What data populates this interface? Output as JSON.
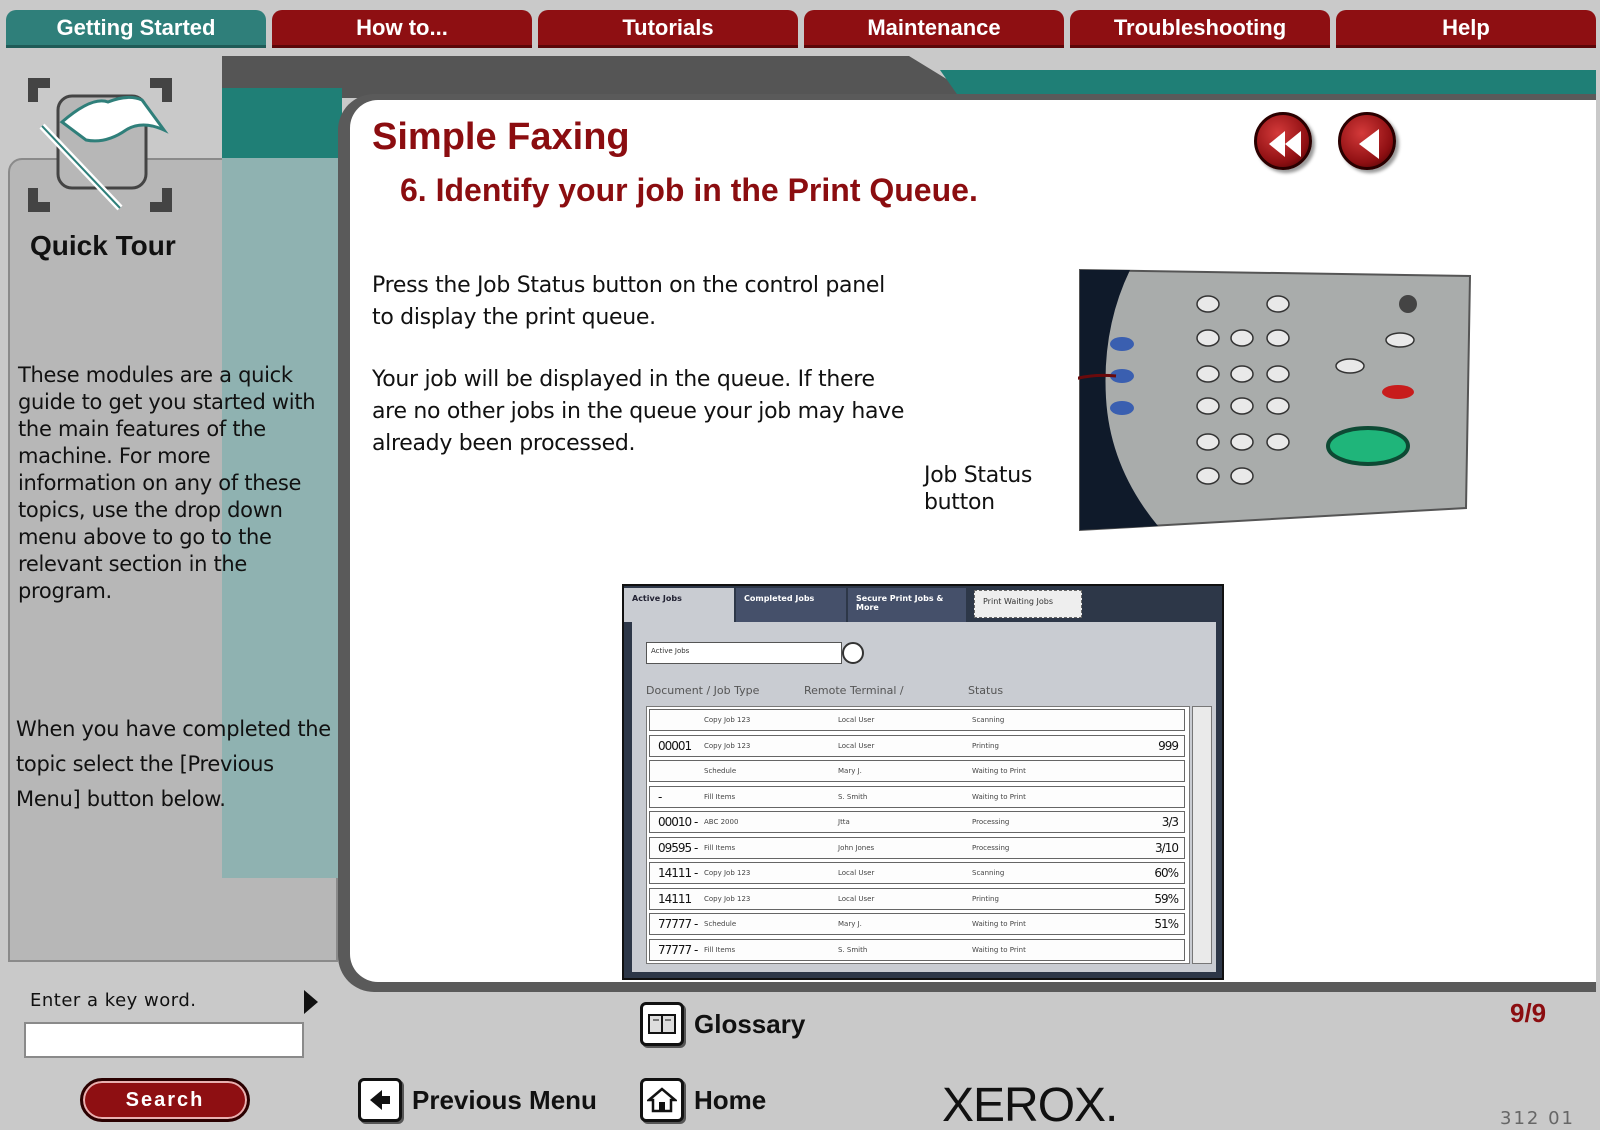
{
  "nav": {
    "tabs": [
      "Getting Started",
      "How to...",
      "Tutorials",
      "Maintenance",
      "Troubleshooting",
      "Help"
    ],
    "active_index": 0
  },
  "sidebar": {
    "title": "Quick Tour",
    "text1": "These modules are a quick guide to get you started with the main features of the machine. For more information on any of these topics, use the drop down menu above to go to the relevant section in the program.",
    "text2": "When you have completed the topic select the [Previous Menu] button below.",
    "keyword_label": "Enter a key word.",
    "keyword_value": "",
    "search_label": "Search"
  },
  "main": {
    "title": "Simple Faxing",
    "subtitle": "6. Identify your job in the Print Queue.",
    "paragraph1": "Press the Job Status button on the control panel to display the print queue.",
    "paragraph2": "Your job will be displayed in the queue.  If there are no other jobs in the queue your job may have already been processed.",
    "callout": "Job Status button",
    "page_indicator": "9/9"
  },
  "print_queue": {
    "tabs": [
      "Active Jobs",
      "Completed Jobs",
      "Secure Print Jobs & More",
      "Print Waiting Jobs"
    ],
    "filter": "Active Jobs",
    "columns": [
      "Document / Job Type",
      "Remote Terminal /",
      "Status"
    ],
    "rows": [
      {
        "id": "",
        "type": "Copy Job 123",
        "terminal": "Local User",
        "status": "Scanning",
        "pct": ""
      },
      {
        "id": "00001",
        "type": "Copy Job 123",
        "terminal": "Local User",
        "status": "Printing",
        "pct": "999"
      },
      {
        "id": "",
        "type": "Schedule",
        "terminal": "Mary J.",
        "status": "Waiting to Print",
        "pct": ""
      },
      {
        "id": "-",
        "type": "Fill Items",
        "terminal": "S. Smith",
        "status": "Waiting to Print",
        "pct": ""
      },
      {
        "id": "00010 -",
        "type": "ABC 2000",
        "terminal": "Jtta",
        "status": "Processing",
        "pct": "3/3"
      },
      {
        "id": "09595 -",
        "type": "Fill Items",
        "terminal": "John Jones",
        "status": "Processing",
        "pct": "3/10"
      },
      {
        "id": "14111 -",
        "type": "Copy Job 123",
        "terminal": "Local User",
        "status": "Scanning",
        "pct": "60%"
      },
      {
        "id": "14111",
        "type": "Copy Job 123",
        "terminal": "Local User",
        "status": "Printing",
        "pct": "59%"
      },
      {
        "id": "77777 -",
        "type": "Schedule",
        "terminal": "Mary J.",
        "status": "Waiting to Print",
        "pct": "51%"
      },
      {
        "id": "77777 -",
        "type": "Fill Items",
        "terminal": "S. Smith",
        "status": "Waiting to Print",
        "pct": ""
      }
    ]
  },
  "footer": {
    "glossary": "Glossary",
    "previous_menu": "Previous Menu",
    "home": "Home",
    "brand": "XEROX.",
    "code": "312 01"
  },
  "colors": {
    "tab_red": "#8e0f12",
    "tab_teal": "#2f7f7a",
    "title_red": "#8b0d10",
    "start_button": "#1fb57a"
  }
}
